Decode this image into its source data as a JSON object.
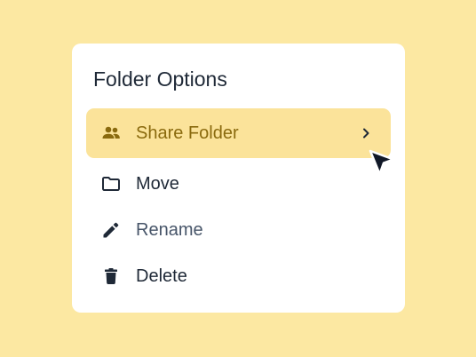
{
  "menu": {
    "title": "Folder Options",
    "items": [
      {
        "label": "Share Folder",
        "icon": "people-icon",
        "active": true,
        "has_submenu": true
      },
      {
        "label": "Move",
        "icon": "folder-icon"
      },
      {
        "label": "Rename",
        "icon": "pencil-icon"
      },
      {
        "label": "Delete",
        "icon": "trash-icon"
      }
    ]
  },
  "colors": {
    "background": "#FCE8A2",
    "card": "#FFFFFF",
    "active_item": "#FBE39A",
    "active_text": "#8A6A0E",
    "text": "#1F2937",
    "muted_text": "#475569",
    "icon": "#1F2937",
    "active_icon": "#8A6A0E"
  }
}
